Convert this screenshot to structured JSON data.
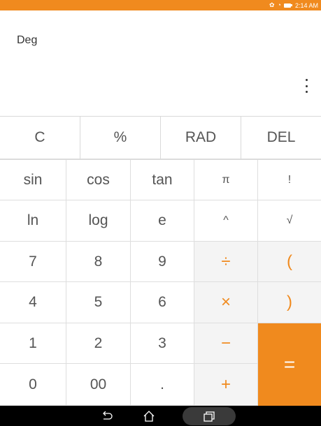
{
  "status_bar": {
    "time": "2:14 AM",
    "icons": [
      "notification-icon",
      "wifi-icon",
      "battery-icon"
    ]
  },
  "display": {
    "mode": "Deg"
  },
  "top_row": [
    "C",
    "%",
    "RAD",
    "DEL"
  ],
  "keys": {
    "sin": "sin",
    "cos": "cos",
    "tan": "tan",
    "pi": "π",
    "fact": "!",
    "ln": "ln",
    "log": "log",
    "e": "e",
    "pow": "^",
    "sqrt": "√",
    "d7": "7",
    "d8": "8",
    "d9": "9",
    "div": "÷",
    "lparen": "(",
    "d4": "4",
    "d5": "5",
    "d6": "6",
    "mul": "×",
    "rparen": ")",
    "d1": "1",
    "d2": "2",
    "d3": "3",
    "sub": "−",
    "eq": "=",
    "d0": "0",
    "d00": "00",
    "dot": ".",
    "add": "+"
  },
  "colors": {
    "accent": "#f08a1e",
    "operator_bg": "#f4f4f4"
  },
  "nav": [
    "back-icon",
    "home-icon",
    "recent-apps-icon"
  ]
}
